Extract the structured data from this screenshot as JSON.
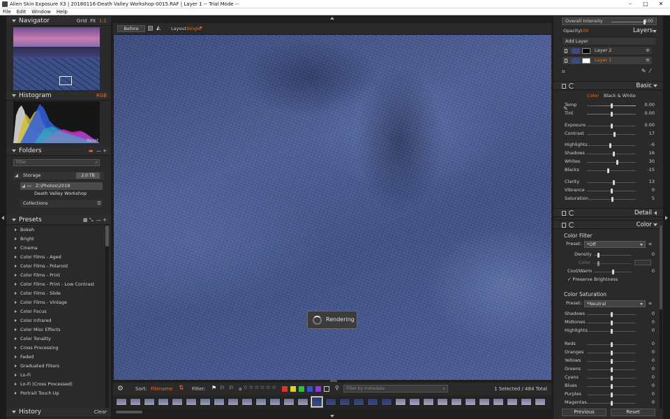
{
  "window": {
    "title": "Alien Skin Exposure X3 | 20180116-Death Valley Workshop-0015.RAF | Layer 1 -- Trial Mode --",
    "min": "–",
    "max": "□",
    "close": "✕"
  },
  "menu": [
    "File",
    "Edit",
    "Window",
    "Help"
  ],
  "left": {
    "navigator": {
      "title": "Navigator",
      "grid": "Grid",
      "fit": "Fit",
      "ratio": "1:1"
    },
    "histogram": {
      "title": "Histogram",
      "mode": "RGB",
      "reset": "Reset"
    },
    "folders": {
      "title": "Folders",
      "filter_placeholder": "Filter",
      "storage": "Storage",
      "storage_size": "2.0 TB",
      "path": "Z:\\Photos\\2018",
      "subfolder": "Death Valley Workshop",
      "collections": "Collections"
    },
    "presets": {
      "title": "Presets",
      "items": [
        "Bokeh",
        "Bright",
        "Cinema",
        "Color Films - Aged",
        "Color Films - Polaroid",
        "Color Films - Print",
        "Color Films - Print - Low Contrast",
        "Color Films - Slide",
        "Color Films - Vintage",
        "Color Focus",
        "Color Infrared",
        "Color Misc Effects",
        "Color Tonality",
        "Cross Processing",
        "Faded",
        "Graduated Filters",
        "Lo-Fi",
        "Lo-Fi (Cross Processed)",
        "Portrait Touch Up"
      ]
    },
    "history": {
      "title": "History",
      "clear": "Clear"
    }
  },
  "toolbar": {
    "before": "Before",
    "layout_label": "Layout:",
    "layout_value": "Single"
  },
  "canvas": {
    "rendering": "Rendering"
  },
  "filterbar": {
    "sort_label": "Sort:",
    "sort_value": "Filename",
    "filter_label": "Filter:",
    "a": "a",
    "search_placeholder": "Filter by metadata",
    "count": "1 Selected / 484 Total",
    "colors": [
      "#e03030",
      "#e0d020",
      "#30c030",
      "#3050e0",
      "#8a3ae0"
    ]
  },
  "right": {
    "overall_intensity": {
      "label": "Overall Intensity",
      "value": "100"
    },
    "opacity": {
      "label": "Opacity:",
      "value": "100",
      "layers_title": "Layers"
    },
    "add_layer": "Add Layer",
    "layers": [
      "Layer 2",
      "Layer 1"
    ],
    "basic": {
      "title": "Basic",
      "tab_color": "Color",
      "tab_bw": "Black & White",
      "sliders": [
        {
          "label": "Temp",
          "value": "0.00"
        },
        {
          "label": "Tint",
          "value": "0.00"
        },
        {
          "label": "Exposure",
          "value": "0.00"
        },
        {
          "label": "Contrast",
          "value": "17"
        },
        {
          "label": "Highlights",
          "value": "-6"
        },
        {
          "label": "Shadows",
          "value": "16"
        },
        {
          "label": "Whites",
          "value": "30"
        },
        {
          "label": "Blacks",
          "value": "-15"
        },
        {
          "label": "Clarity",
          "value": "13"
        },
        {
          "label": "Vibrance",
          "value": "0"
        },
        {
          "label": "Saturation",
          "value": "5"
        }
      ]
    },
    "detail": {
      "title": "Detail"
    },
    "color": {
      "title": "Color",
      "filter_title": "Color Filter",
      "preset_label": "Preset:",
      "filter_preset": "*Off",
      "density": {
        "label": "Density",
        "value": "0"
      },
      "color_label": "Color",
      "coolwarm": {
        "label": "Cool/Warm",
        "value": "0"
      },
      "preserve": "Preserve Brightness",
      "saturation_title": "Color Saturation",
      "sat_preset": "*Neutral",
      "sat_sliders": [
        {
          "label": "Shadows",
          "value": "0"
        },
        {
          "label": "Midtones",
          "value": "0"
        },
        {
          "label": "Highlights",
          "value": "0"
        },
        {
          "label": "Reds",
          "value": "0"
        },
        {
          "label": "Oranges",
          "value": "0"
        },
        {
          "label": "Yellows",
          "value": "0"
        },
        {
          "label": "Greens",
          "value": "0"
        },
        {
          "label": "Cyans",
          "value": "0"
        },
        {
          "label": "Blues",
          "value": "0"
        },
        {
          "label": "Purples",
          "value": "0"
        },
        {
          "label": "Magentas",
          "value": "0"
        }
      ]
    },
    "previous": "Previous",
    "reset": "Reset"
  }
}
